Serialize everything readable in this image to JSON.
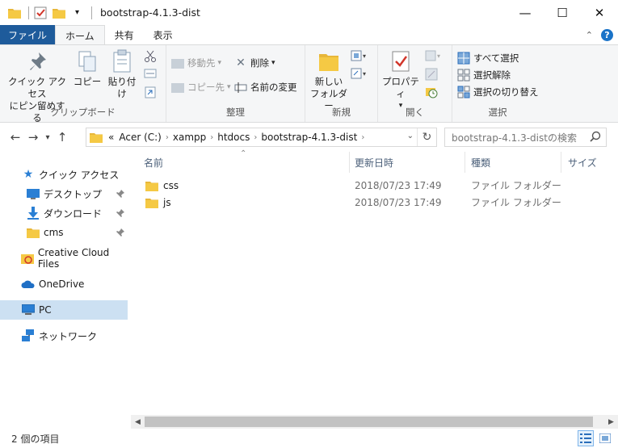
{
  "window": {
    "title": "bootstrap-4.1.3-dist"
  },
  "tabs": {
    "file": "ファイル",
    "home": "ホーム",
    "share": "共有",
    "view": "表示"
  },
  "ribbon": {
    "clipboard": {
      "label": "クリップボード",
      "pin": "クイック アクセス\nにピン留めする",
      "copy": "コピー",
      "paste": "貼り付け"
    },
    "organize": {
      "label": "整理",
      "move_to": "移動先",
      "copy_to": "コピー先",
      "delete": "削除",
      "rename": "名前の変更"
    },
    "new": {
      "label": "新規",
      "new_folder": "新しい\nフォルダー"
    },
    "open": {
      "label": "開く",
      "properties": "プロパティ"
    },
    "select": {
      "label": "選択",
      "select_all": "すべて選択",
      "select_none": "選択解除",
      "invert": "選択の切り替え"
    }
  },
  "address": {
    "prefix": "«",
    "crumbs": [
      "Acer (C:)",
      "xampp",
      "htdocs",
      "bootstrap-4.1.3-dist"
    ],
    "search_placeholder": "bootstrap-4.1.3-distの検索"
  },
  "nav": {
    "quick_access": "クイック アクセス",
    "desktop": "デスクトップ",
    "downloads": "ダウンロード",
    "cms": "cms",
    "creative_cloud": "Creative Cloud Files",
    "onedrive": "OneDrive",
    "pc": "PC",
    "network": "ネットワーク"
  },
  "columns": {
    "name": "名前",
    "date": "更新日時",
    "type": "種類",
    "size": "サイズ"
  },
  "files": [
    {
      "name": "css",
      "date": "2018/07/23 17:49",
      "type": "ファイル フォルダー"
    },
    {
      "name": "js",
      "date": "2018/07/23 17:49",
      "type": "ファイル フォルダー"
    }
  ],
  "status": {
    "count": "2 個の項目"
  },
  "colors": {
    "accent": "#1e5b9b",
    "folder": "#f5c944",
    "selection": "#cce0f2"
  }
}
